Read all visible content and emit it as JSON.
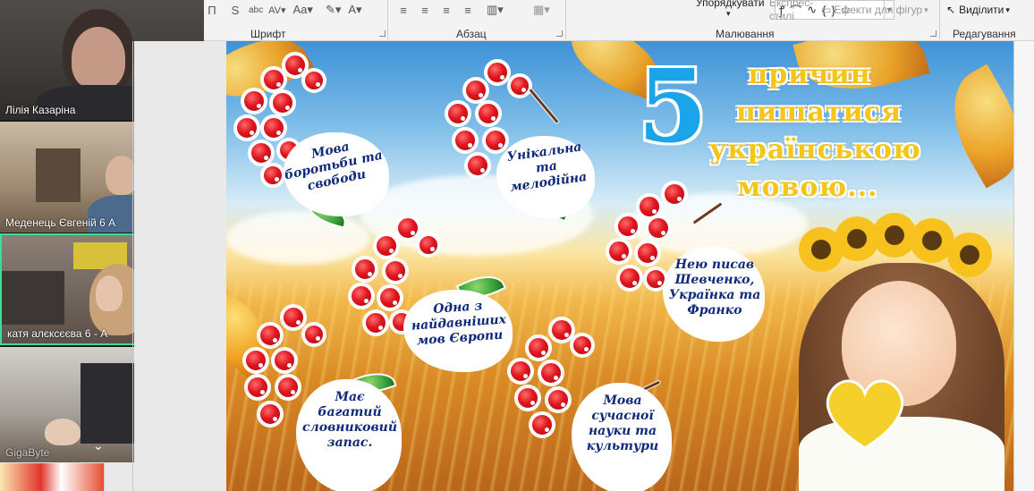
{
  "ribbon": {
    "font_group_label": "Шрифт",
    "paragraph_group_label": "Абзац",
    "drawing_group_label": "Малювання",
    "editing_group_label": "Редагування",
    "arrange_label": "Упорядкувати",
    "quick_styles_label": "Експрес-стилі",
    "shape_effects_label": "Ефекти для фігур",
    "select_label": "Виділити"
  },
  "participants": [
    {
      "name": "Лілія Казаріна"
    },
    {
      "name": "Меденець Євгеній 6 А"
    },
    {
      "name": "катя алєксєєва 6 - А"
    },
    {
      "name": "GigaByte"
    }
  ],
  "slide": {
    "number": "5",
    "title_lines": [
      "причин",
      "пишатися",
      "українською",
      "мовою..."
    ],
    "reasons": [
      [
        "Мова",
        "боротьби та",
        "свободи"
      ],
      [
        "Унікальна",
        "та",
        "мелодійна"
      ],
      [
        "Одна з",
        "найдавніших",
        "мов Європи"
      ],
      [
        "Нею писав",
        "Шевченко,",
        "Українка та",
        "Франко"
      ],
      [
        "Має",
        "багатий",
        "словниковий",
        "запас."
      ],
      [
        "Мова",
        "сучасної",
        "науки та",
        "культури"
      ]
    ]
  },
  "colors": {
    "accent_number": "#1aa5ea",
    "title_text": "#f5c518",
    "caption_text": "#0f2a7a",
    "active_tile_border": "#3ddc97"
  }
}
